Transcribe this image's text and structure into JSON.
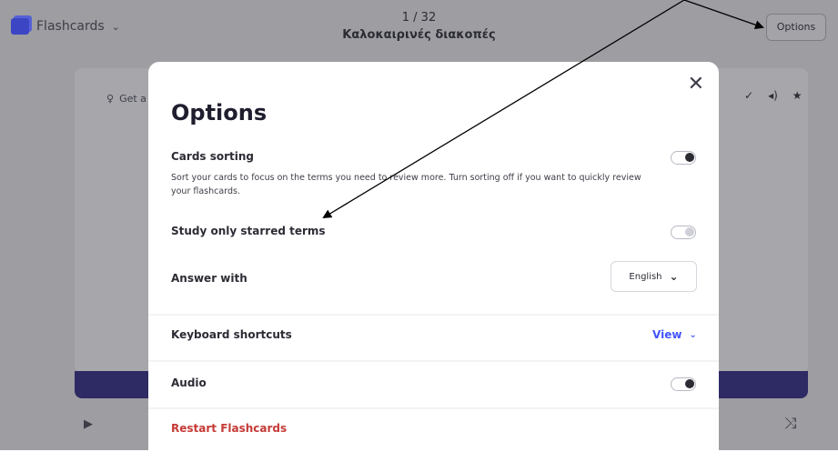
{
  "topbar": {
    "mode_label": "Flashcards",
    "counter": "1 / 32",
    "set_title": "Καλοκαιρινές διακοπές",
    "options_label": "Options"
  },
  "card": {
    "hint_label": "Get a",
    "tool_icons": [
      "pencil-icon",
      "sound-icon",
      "star-icon"
    ]
  },
  "modal": {
    "title": "Options",
    "cards_sorting": {
      "label": "Cards sorting",
      "description": "Sort your cards to focus on the terms you need to review more. Turn sorting off if you want to quickly review your flashcards."
    },
    "starred": {
      "label": "Study only starred terms"
    },
    "answer_with": {
      "label": "Answer with",
      "value": "English"
    },
    "keyboard_shortcuts": {
      "label": "Keyboard shortcuts",
      "link": "View"
    },
    "audio": {
      "label": "Audio"
    },
    "restart": {
      "label": "Restart Flashcards"
    }
  },
  "colors": {
    "accent": "#4255ff",
    "danger": "#c53a36",
    "progress": "#2e2a63",
    "overlay": "#9d9da2"
  }
}
